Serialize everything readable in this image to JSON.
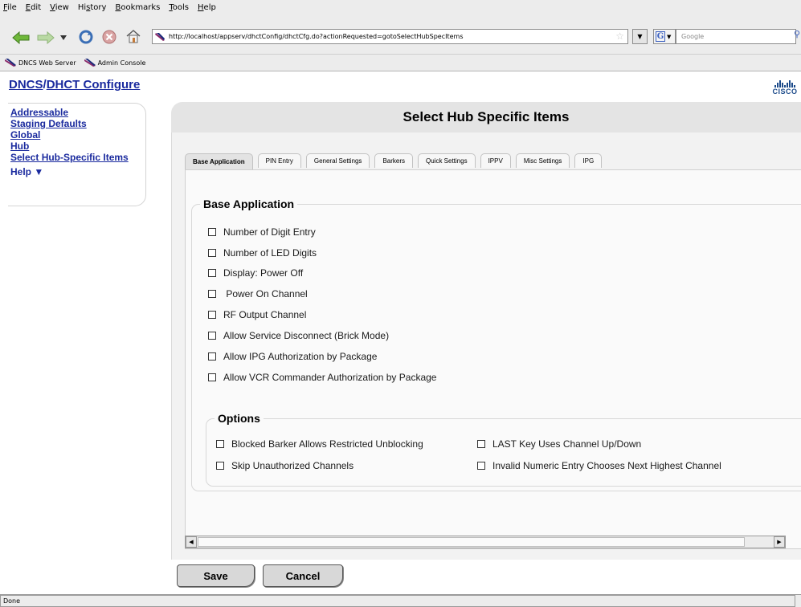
{
  "browser": {
    "menu": [
      {
        "pre": "",
        "u": "F",
        "post": "ile"
      },
      {
        "pre": "",
        "u": "E",
        "post": "dit"
      },
      {
        "pre": "",
        "u": "V",
        "post": "iew"
      },
      {
        "pre": "Hi",
        "u": "s",
        "post": "tory"
      },
      {
        "pre": "",
        "u": "B",
        "post": "ookmarks"
      },
      {
        "pre": "",
        "u": "T",
        "post": "ools"
      },
      {
        "pre": "",
        "u": "H",
        "post": "elp"
      }
    ],
    "url": "http://localhost/appserv/dhctConfig/dhctCfg.do?actionRequested=gotoSelectHubSpecItems",
    "search_placeholder": "Google",
    "bookmarks": [
      "DNCS Web Server",
      "Admin Console"
    ],
    "status": "Done",
    "icons": [
      "back-arrow-icon",
      "forward-arrow-icon",
      "history-dropdown-icon",
      "reload-icon",
      "stop-icon",
      "home-icon"
    ]
  },
  "header": {
    "title_part1": "DNCS",
    "separator": "/",
    "title_part2": "DHCT Configure",
    "logo_text": "CISCO"
  },
  "sidebar": {
    "links": [
      "Addressable",
      "Staging Defaults",
      "Global",
      "Hub",
      "Select Hub-Specific Items"
    ],
    "help": "Help ▼"
  },
  "main": {
    "title": "Select Hub Specific Items",
    "tabs": [
      "Base Application",
      "PIN Entry",
      "General Settings",
      "Barkers",
      "Quick Settings",
      "IPPV",
      "Misc Settings",
      "IPG"
    ],
    "active_tab": "Base Application",
    "base_section": {
      "legend": "Base Application",
      "items": [
        {
          "label": "Number of Digit Entry",
          "checked": false
        },
        {
          "label": "Number of LED Digits",
          "checked": false
        },
        {
          "label": "Display: Power Off",
          "checked": false
        },
        {
          "label": " Power On Channel",
          "checked": false
        },
        {
          "label": "RF Output Channel",
          "checked": false
        },
        {
          "label": "Allow Service Disconnect (Brick Mode)",
          "checked": false
        },
        {
          "label": "Allow IPG Authorization by Package",
          "checked": false
        },
        {
          "label": "Allow VCR Commander Authorization by Package",
          "checked": false
        }
      ]
    },
    "options_section": {
      "legend": "Options",
      "items": [
        {
          "label": "Blocked Barker Allows Restricted Unblocking",
          "checked": false
        },
        {
          "label": "LAST Key Uses Channel Up/Down",
          "checked": false
        },
        {
          "label": "Skip Unauthorized Channels",
          "checked": false
        },
        {
          "label": "Invalid Numeric Entry Chooses Next Highest Channel",
          "checked": false
        }
      ]
    }
  },
  "actions": {
    "save_label": "Save",
    "cancel_label": "Cancel"
  }
}
